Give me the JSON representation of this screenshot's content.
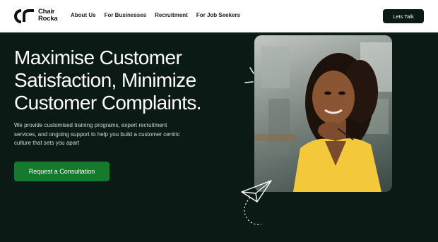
{
  "brand": {
    "logo_line1": "Chair",
    "logo_line2": "Rocka"
  },
  "nav": {
    "items": [
      {
        "label": "About Us"
      },
      {
        "label": "For Businesses"
      },
      {
        "label": "Recruitment"
      },
      {
        "label": "For Job Seekers"
      }
    ],
    "cta_label": "Lets Talk"
  },
  "hero": {
    "headline_line1": "Maximise Customer",
    "headline_line2": "Satisfaction, Minimize",
    "headline_line3": "Customer Complaints.",
    "description": "We provide customised training programs, expert recruitment services, and ongoing support to help you build a customer centric culture that sets you apart",
    "cta_label": "Request a Consultation"
  },
  "colors": {
    "background": "#0b1a14",
    "accent_green": "#147a2e",
    "nav_background": "#ffffff",
    "shirt_yellow": "#f3c93b"
  },
  "icons": [
    "logo-mark-icon",
    "sparkle-lines-icon",
    "paper-plane-icon"
  ]
}
